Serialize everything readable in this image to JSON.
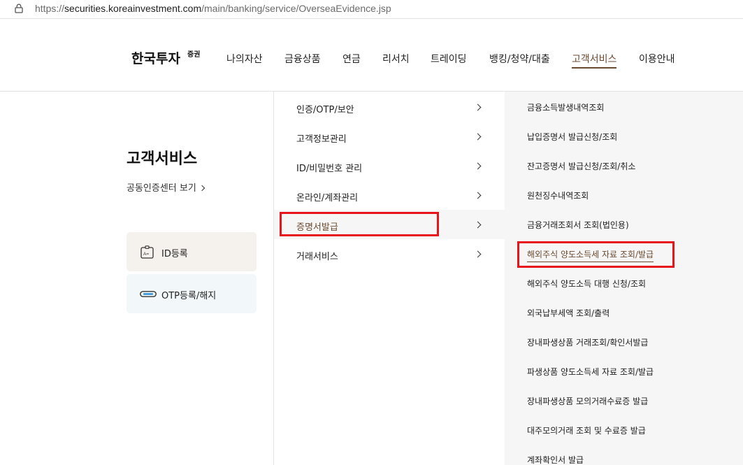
{
  "browser": {
    "url_prefix": "https://",
    "url_host": "securities.koreainvestment.com",
    "url_path": "/main/banking/service/OverseaEvidence.jsp"
  },
  "header": {
    "logo_main": "한국투자",
    "logo_sup": "증권",
    "nav": [
      "나의자산",
      "금융상품",
      "연금",
      "리서치",
      "트레이딩",
      "뱅킹/청약/대출",
      "고객서비스",
      "이용안내"
    ],
    "active_nav": "고객서비스"
  },
  "sidebar": {
    "title": "고객서비스",
    "cert_link": "공동인증센터 보기",
    "quick": [
      {
        "label": "ID등록",
        "icon": "id-card-icon"
      },
      {
        "label": "OTP등록/해지",
        "icon": "otp-device-icon"
      }
    ]
  },
  "menu": {
    "items": [
      "인증/OTP/보안",
      "고객정보관리",
      "ID/비밀번호 관리",
      "온라인/계좌관리",
      "증명서발급",
      "거래서비스"
    ],
    "active": "증명서발급"
  },
  "submenu": {
    "items": [
      "금융소득발생내역조회",
      "납입증명서 발급신청/조회",
      "잔고증명서 발급신청/조회/취소",
      "원천징수내역조회",
      "금융거래조회서 조회(법인용)",
      "해외주식 양도소득세 자료 조회/발급",
      "해외주식 양도소득 대행 신청/조회",
      "외국납부세액 조회/출력",
      "장내파생상품 거래조회/확인서발급",
      "파생상품 양도소득세 자료 조회/발급",
      "장내파생상품 모의거래수료증 발급",
      "대주모의거래 조회 및 수료증 발급",
      "계좌확인서 발급"
    ],
    "active": "해외주식 양도소득세 자료 조회/발급"
  },
  "colors": {
    "accent": "#6b4a2f",
    "highlight": "#e8141b",
    "panel_bg": "#f6f6f6"
  }
}
